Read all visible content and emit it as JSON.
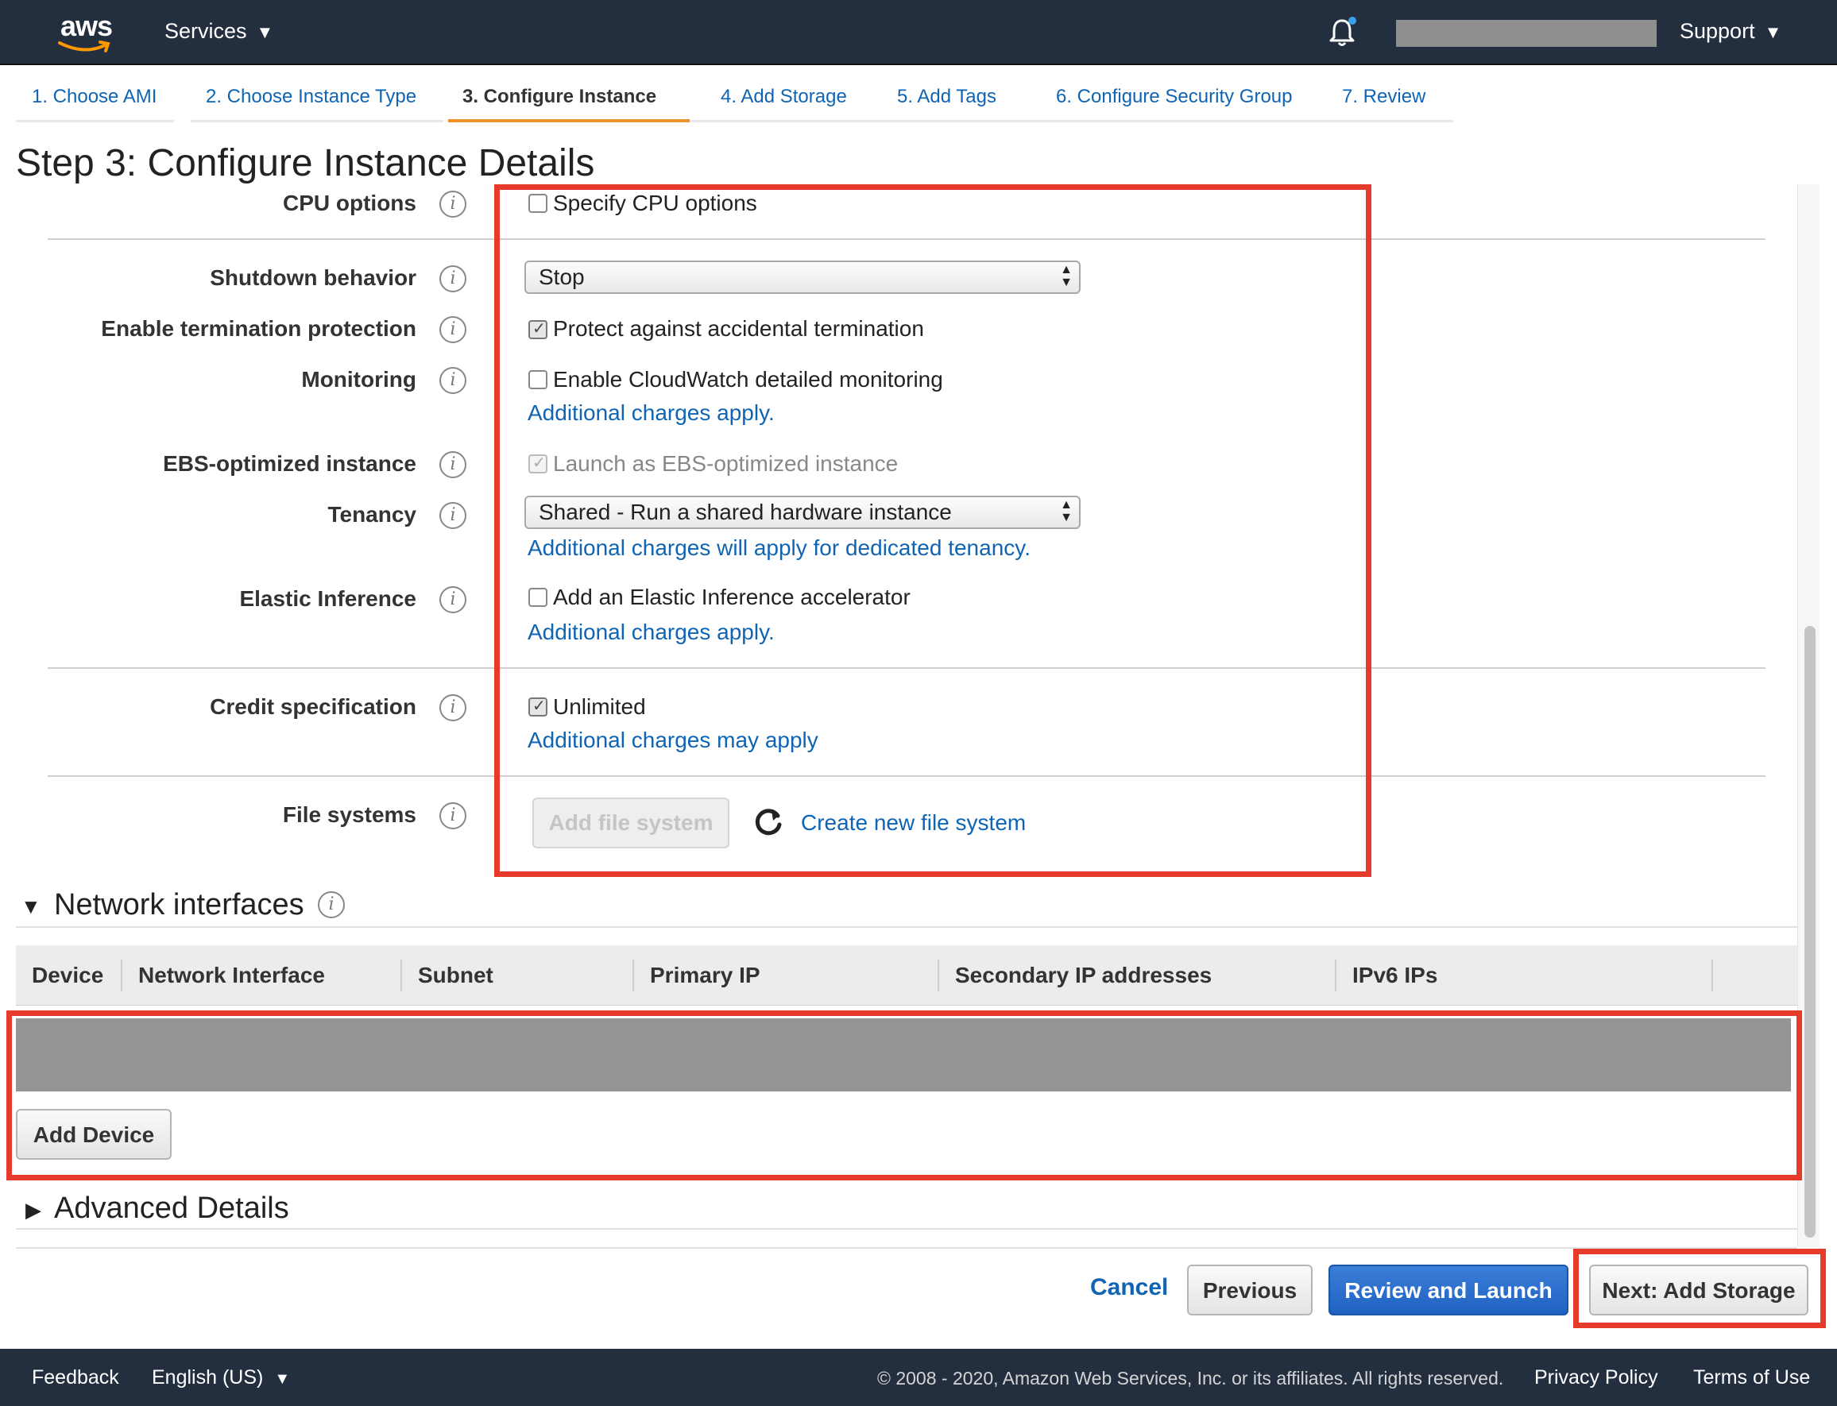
{
  "nav": {
    "logo_text": "aws",
    "services_label": "Services",
    "support_label": "Support"
  },
  "tabs": [
    {
      "label": "1. Choose AMI"
    },
    {
      "label": "2. Choose Instance Type"
    },
    {
      "label": "3. Configure Instance"
    },
    {
      "label": "4. Add Storage"
    },
    {
      "label": "5. Add Tags"
    },
    {
      "label": "6. Configure Security Group"
    },
    {
      "label": "7. Review"
    }
  ],
  "page_title": "Step 3: Configure Instance Details",
  "info_glyph": "i",
  "form": {
    "cpu_options": {
      "label": "CPU options",
      "checkbox": "Specify CPU options"
    },
    "shutdown": {
      "label": "Shutdown behavior",
      "value": "Stop"
    },
    "termination": {
      "label": "Enable termination protection",
      "checkbox": "Protect against accidental termination"
    },
    "monitoring": {
      "label": "Monitoring",
      "checkbox": "Enable CloudWatch detailed monitoring",
      "link": "Additional charges apply."
    },
    "ebs": {
      "label": "EBS-optimized instance",
      "checkbox": "Launch as EBS-optimized instance"
    },
    "tenancy": {
      "label": "Tenancy",
      "value": "Shared - Run a shared hardware instance",
      "link": "Additional charges will apply for dedicated tenancy."
    },
    "elastic_inference": {
      "label": "Elastic Inference",
      "checkbox": "Add an Elastic Inference accelerator",
      "link": "Additional charges apply."
    },
    "credit": {
      "label": "Credit specification",
      "checkbox": "Unlimited",
      "link": "Additional charges may apply"
    },
    "file_systems": {
      "label": "File systems",
      "add_button": "Add file system",
      "create_link": "Create new file system"
    }
  },
  "network": {
    "title": "Network interfaces",
    "columns": [
      "Device",
      "Network Interface",
      "Subnet",
      "Primary IP",
      "Secondary IP addresses",
      "IPv6 IPs"
    ],
    "add_device": "Add Device"
  },
  "advanced": {
    "title": "Advanced Details"
  },
  "actions": {
    "cancel": "Cancel",
    "previous": "Previous",
    "review_launch": "Review and Launch",
    "next": "Next: Add Storage"
  },
  "footer": {
    "feedback": "Feedback",
    "language": "English (US)",
    "copyright": "© 2008 - 2020, Amazon Web Services, Inc. or its affiliates. All rights reserved.",
    "privacy": "Privacy Policy",
    "terms": "Terms of Use"
  },
  "colors": {
    "nav_bg": "#232f3e",
    "link": "#0f64b4",
    "active_tab": "#f0932b",
    "primary_button": "#1f62c2",
    "annotation": "#e63b2a"
  }
}
